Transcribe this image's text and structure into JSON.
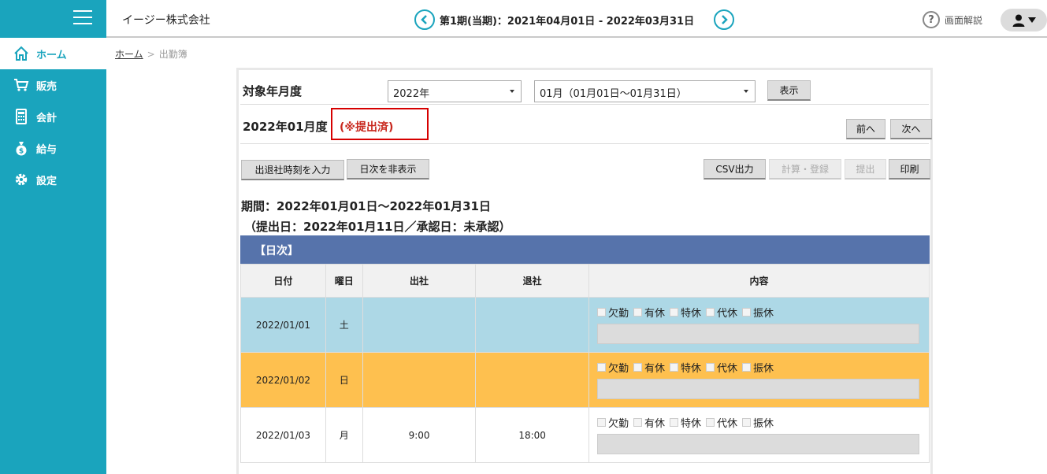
{
  "header": {
    "company": "イージー株式会社",
    "period": "第1期(当期)：2021年04月01日 - 2022年03月31日",
    "help_label": "画面解説",
    "help_glyph": "?"
  },
  "sidebar": {
    "items": [
      {
        "label": "ホーム",
        "icon": "home-icon"
      },
      {
        "label": "販売",
        "icon": "cart-icon"
      },
      {
        "label": "会計",
        "icon": "calculator-icon"
      },
      {
        "label": "給与",
        "icon": "money-bag-icon"
      },
      {
        "label": "設定",
        "icon": "gear-icon"
      }
    ]
  },
  "breadcrumb": {
    "home": "ホーム",
    "sep": ">",
    "current": "出勤簿"
  },
  "filter": {
    "label": "対象年月度",
    "year": "2022年",
    "month": "01月（01月01日～01月31日）",
    "show_button": "表示"
  },
  "title": {
    "month": "2022年01月度",
    "status": "(※提出済)",
    "prev": "前へ",
    "next": "次へ"
  },
  "toolbar": {
    "input_times": "出退社時刻を入力",
    "hide_daily": "日次を非表示",
    "csv": "CSV出力",
    "calc": "計算・登録",
    "submit": "提出",
    "print": "印刷"
  },
  "summary": {
    "period": "期間：2022年01月01日～2022年01月31日",
    "submit_info": "（提出日：2022年01月11日／承認日：未承認）"
  },
  "daily": {
    "header": "【日次】",
    "columns": [
      "日付",
      "曜日",
      "出社",
      "退社",
      "内容"
    ],
    "leave_types": [
      "欠勤",
      "有休",
      "特休",
      "代休",
      "振休"
    ],
    "rows": [
      {
        "date": "2022/01/01",
        "weekday": "土",
        "in": "",
        "out": ""
      },
      {
        "date": "2022/01/02",
        "weekday": "日",
        "in": "",
        "out": ""
      },
      {
        "date": "2022/01/03",
        "weekday": "月",
        "in": "9:00",
        "out": "18:00"
      }
    ]
  },
  "colors": {
    "sidebar": "#1aa4bd",
    "saturday": "#add8e6",
    "sunday": "#fec04f",
    "daily_header": "#5673ab",
    "status_red": "#c8281e"
  }
}
